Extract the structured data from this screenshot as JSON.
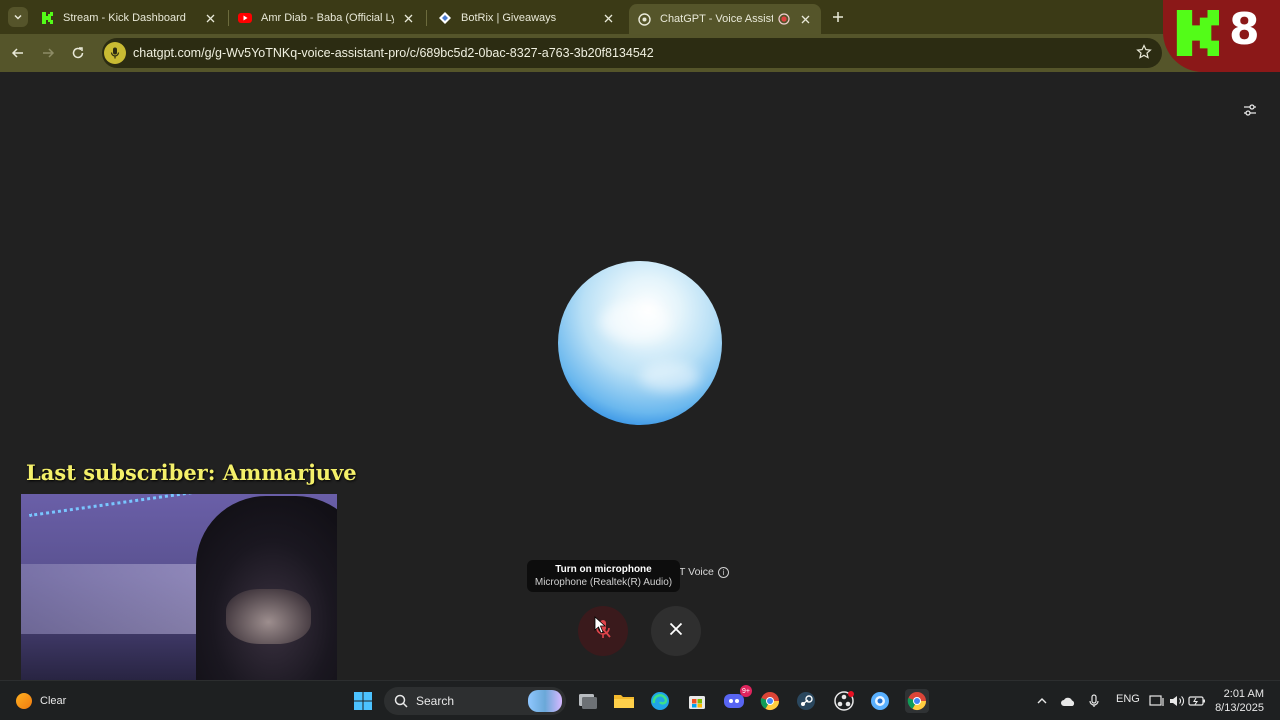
{
  "browser": {
    "tabs": [
      {
        "title": "Stream - Kick Dashboard",
        "favicon": "kick-icon",
        "active": false
      },
      {
        "title": "Amr Diab - Baba (Official Lyric V",
        "favicon": "youtube-icon",
        "active": false
      },
      {
        "title": "BotRix | Giveaways",
        "favicon": "botrix-icon",
        "active": false
      },
      {
        "title": "ChatGPT - Voice Assistant P",
        "favicon": "chatgpt-icon",
        "active": true,
        "recording": true
      }
    ],
    "url": "chatgpt.com/g/g-Wv5YoTNKq-voice-assistant-pro/c/689bc5d2-0bac-8327-a763-3b20f8134542",
    "accent_color": "#55552a"
  },
  "overlay": {
    "kick_count": "8",
    "last_subscriber": "Last subscriber: Ammarjuve",
    "badge_color": "#8b1818"
  },
  "voice": {
    "label": "PT Voice",
    "tooltip_title": "Turn on microphone",
    "tooltip_subtitle": "Microphone (Realtek(R) Audio)",
    "mic_state": "muted"
  },
  "taskbar": {
    "weather": "Clear",
    "search_placeholder": "Search",
    "discord_badge": "9+",
    "language": "ENG",
    "time": "2:01 AM",
    "date": "8/13/2025"
  }
}
